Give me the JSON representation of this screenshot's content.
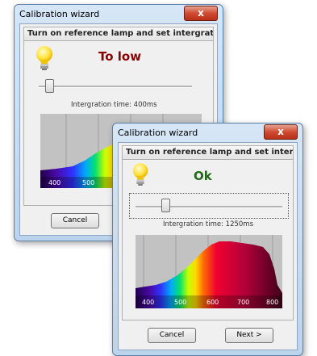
{
  "windows": [
    {
      "title": "Calibration wizard",
      "close_label": "x",
      "header": "Turn on reference lamp and set intergration time",
      "status": "To low",
      "status_color": "#8b0000",
      "integration_label": "Intergration time:",
      "integration_value": "400ms",
      "slider_position": 0.08,
      "ticks": [
        "400",
        "500"
      ],
      "buttons": {
        "cancel": "Cancel"
      }
    },
    {
      "title": "Calibration wizard",
      "close_label": "x",
      "header": "Turn on reference lamp and set intergration time",
      "status": "Ok",
      "status_color": "#1e6b14",
      "integration_label": "Intergration time:",
      "integration_value": "1250ms",
      "slider_position": 0.24,
      "ticks": [
        "400",
        "500",
        "600",
        "700",
        "800"
      ],
      "buttons": {
        "cancel": "Cancel",
        "next": "Next >"
      }
    }
  ],
  "icons": {
    "lamp": "lightbulb-icon"
  }
}
